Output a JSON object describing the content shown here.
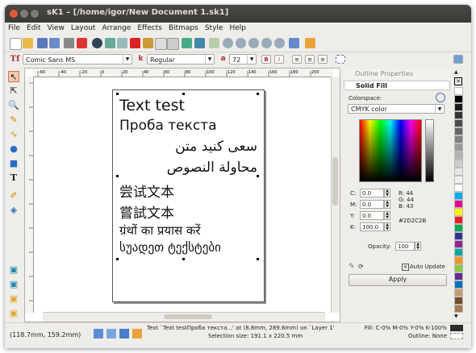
{
  "window": {
    "title": "sK1 – [/home/igor/New Document 1.sk1]"
  },
  "menu": {
    "items": [
      "File",
      "Edit",
      "View",
      "Layout",
      "Arrange",
      "Effects",
      "Bitmaps",
      "Style",
      "Help"
    ]
  },
  "font": {
    "family": "Comic Sans MS",
    "style": "Regular",
    "size": "72",
    "bold": "B",
    "italic": "I"
  },
  "canvas": {
    "ruler_ticks": [
      "-60",
      "-40",
      "-20",
      "0",
      "20",
      "40",
      "60",
      "80",
      "100",
      "120",
      "140",
      "160",
      "180",
      "200"
    ],
    "text_lines": [
      "Text test",
      "Проба текста",
      "سعى كنيد متن",
      "محاولة النصوص",
      "尝试文本",
      "嘗試文本",
      "ग्रंथों का प्रयास करें",
      "სუადეთ ტექსტები"
    ]
  },
  "panel": {
    "outline_title": "Outline Properties",
    "solid_title": "Solid Fill",
    "colorspace_label": "Colorspace:",
    "colorspace_value": "CMYK color",
    "c_label": "C:",
    "c_val": "0.0",
    "m_label": "M:",
    "m_val": "0.0",
    "y_label": "Y:",
    "y_val": "0.0",
    "k_label": "K:",
    "k_val": "100.0",
    "r": "R: 44",
    "g": "G: 44",
    "b": "B: 43",
    "hex": "#2D2C2B",
    "opacity_label": "Opacity:",
    "opacity_val": "100",
    "auto_update": "Auto Update",
    "apply": "Apply"
  },
  "palette": {
    "colors": [
      "#ffffff",
      "#000000",
      "#1a1a1a",
      "#333333",
      "#4d4d4d",
      "#666666",
      "#808080",
      "#999999",
      "#b3b3b3",
      "#cccccc",
      "#e6e6e6",
      "#f2f2f2",
      "#ffffff",
      "#00aeef",
      "#ec008c",
      "#fff200",
      "#ed1c24",
      "#00a651",
      "#2e3192",
      "#92278f",
      "#00a99d",
      "#f7941d",
      "#8dc63f",
      "#662d91",
      "#0072bc",
      "#c69c6d",
      "#754c24",
      "#a67c52"
    ]
  },
  "status": {
    "coords": "(118.7mm, 159.2mm)",
    "object_text": "Text `Text testПроба текста...' at (8.8mm, 289.6mm) on `Layer 1'",
    "selection_size": "Selection size: 191.1 x 220.5 mm",
    "fill": "Fill: C-0% M-0% Y-0% K-100%",
    "outline": "Outline: None"
  },
  "colors": {
    "accent": "#f07746",
    "title_bg": "#3c3b37",
    "window_bg": "#efedea"
  }
}
